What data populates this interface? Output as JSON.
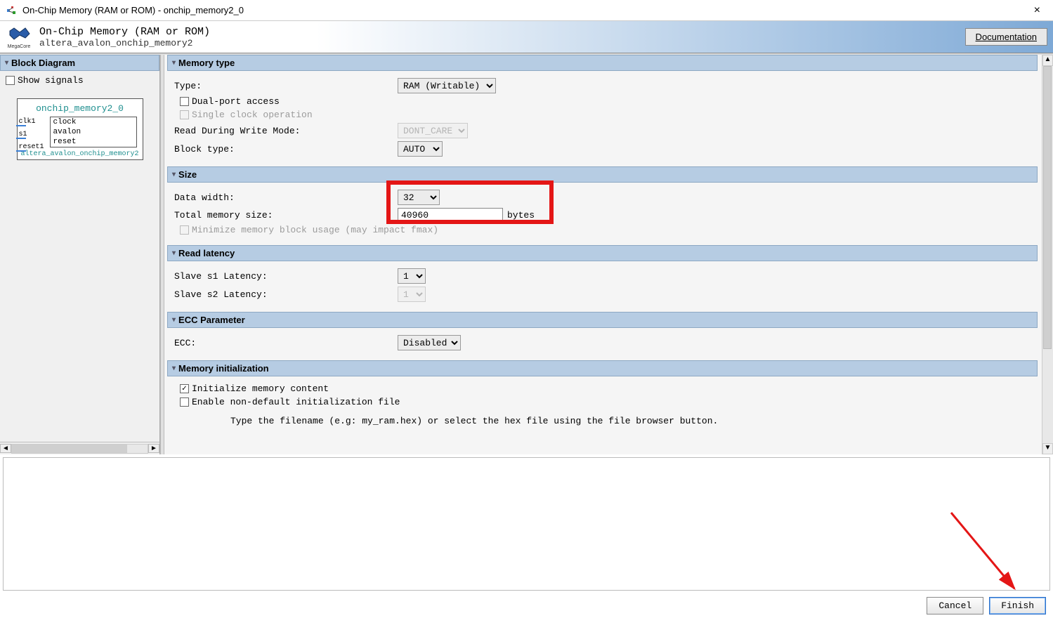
{
  "window": {
    "title": "On-Chip Memory (RAM or ROM) - onchip_memory2_0"
  },
  "header": {
    "title": "On-Chip Memory (RAM or ROM)",
    "subtitle": "altera_avalon_onchip_memory2",
    "doc_button": "Documentation",
    "logo_label": "MegaCore"
  },
  "left": {
    "section_title": "Block Diagram",
    "show_signals": "Show signals",
    "diagram": {
      "name": "onchip_memory2_0",
      "ports": [
        "clk1",
        "s1",
        "reset1"
      ],
      "signals": [
        "clock",
        "avalon",
        "reset"
      ],
      "footer": "altera_avalon_onchip_memory2"
    }
  },
  "sections": {
    "memory_type": {
      "title": "Memory type",
      "type_label": "Type:",
      "type_value": "RAM (Writable)",
      "dual_port": "Dual-port access",
      "single_clock": "Single clock operation",
      "rw_mode_label": "Read During Write Mode:",
      "rw_mode_value": "DONT_CARE",
      "block_type_label": "Block type:",
      "block_type_value": "AUTO"
    },
    "size": {
      "title": "Size",
      "data_width_label": "Data width:",
      "data_width_value": "32",
      "total_label": "Total memory size:",
      "total_value": "40960",
      "unit": "bytes",
      "minimize": "Minimize memory block usage (may impact fmax)"
    },
    "read_latency": {
      "title": "Read latency",
      "s1_label": "Slave s1 Latency:",
      "s1_value": "1",
      "s2_label": "Slave s2 Latency:",
      "s2_value": "1"
    },
    "ecc": {
      "title": "ECC Parameter",
      "ecc_label": "ECC:",
      "ecc_value": "Disabled"
    },
    "mem_init": {
      "title": "Memory initialization",
      "init_content": "Initialize memory content",
      "enable_nondefault": "Enable non-default initialization file",
      "hint": "Type the filename (e.g: my_ram.hex) or select the hex file using the file browser button."
    }
  },
  "footer": {
    "cancel": "Cancel",
    "finish": "Finish"
  }
}
